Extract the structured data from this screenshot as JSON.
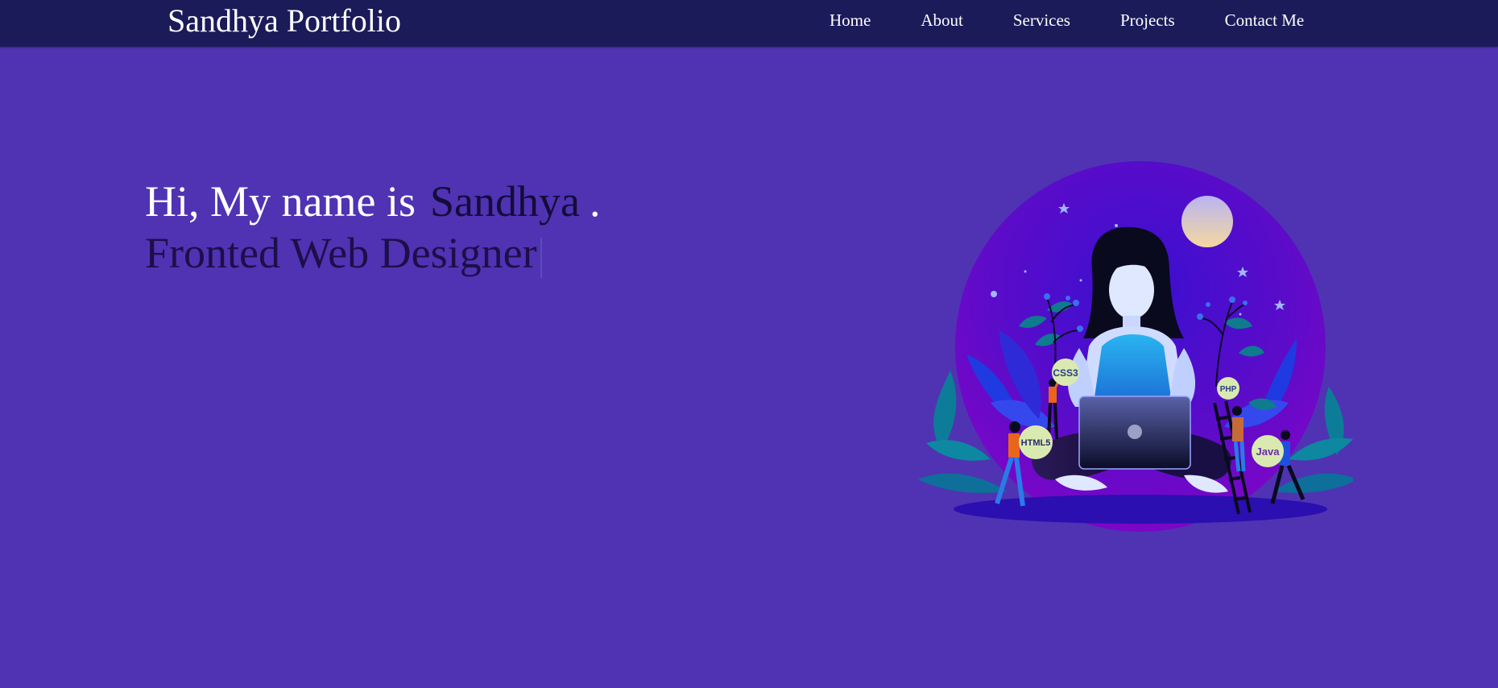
{
  "nav": {
    "brand": "Sandhya Portfolio",
    "items": [
      {
        "label": "Home"
      },
      {
        "label": "About"
      },
      {
        "label": "Services"
      },
      {
        "label": "Projects"
      },
      {
        "label": "Contact Me"
      }
    ]
  },
  "hero": {
    "greeting": "Hi, My name is",
    "name": "Sandhya",
    "punctuation": ".",
    "role": "Fronted Web Designer"
  },
  "illustration": {
    "badges": {
      "css": "CSS3",
      "php": "PHP",
      "html": "HTML5",
      "java": "Java"
    }
  },
  "colors": {
    "page_background": "#4f33b3",
    "navbar_background": "#1b1b5a",
    "name_text": "#140c3a",
    "role_text": "#1c0f4a"
  }
}
